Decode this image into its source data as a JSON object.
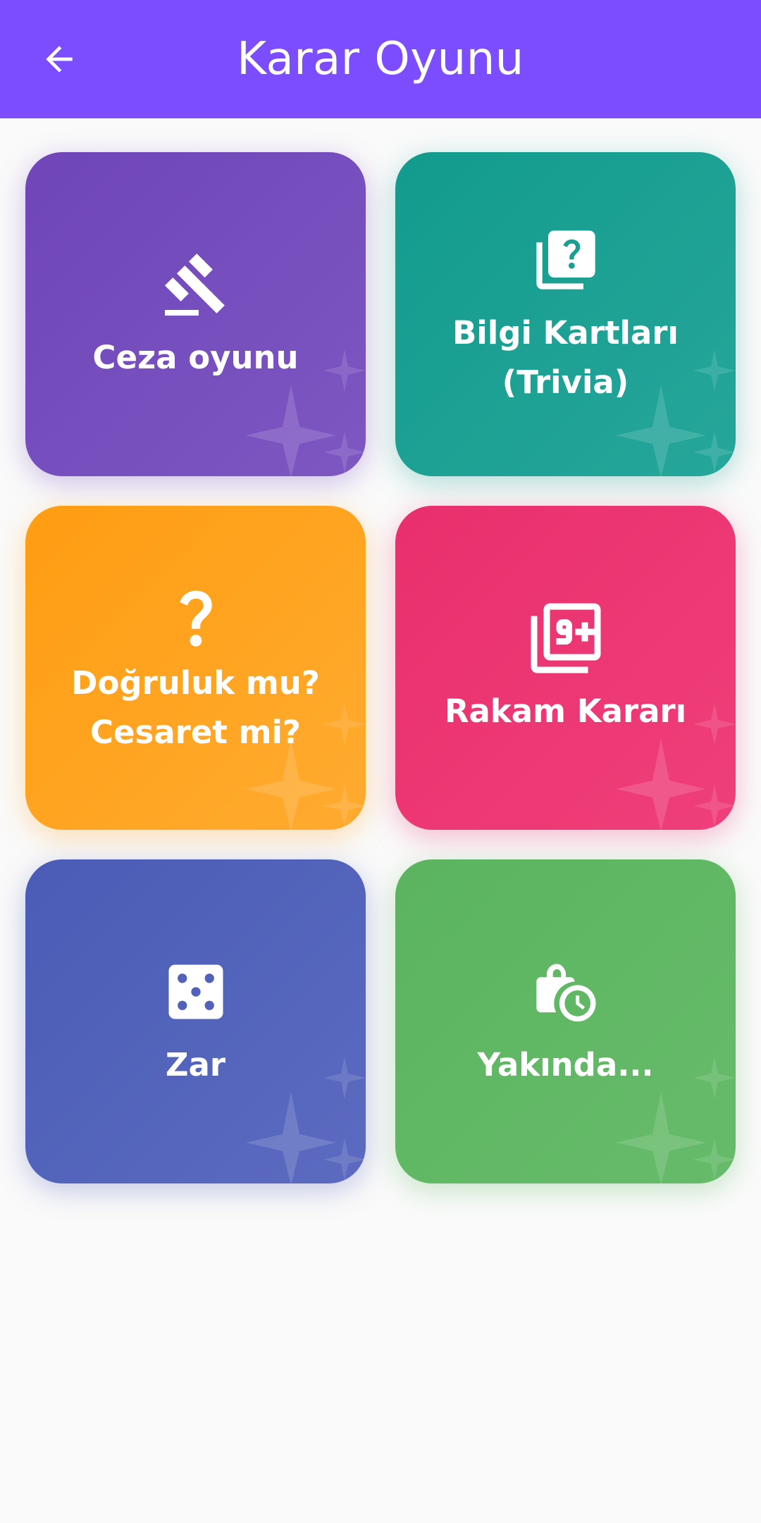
{
  "app_bar": {
    "title": "Karar Oyunu",
    "back_icon": "arrow-back-icon",
    "color": "#7c4dff"
  },
  "cards": [
    {
      "label": "Ceza oyunu",
      "icon": "gavel-icon",
      "color": "#7e57c2"
    },
    {
      "label": "Bilgi Kartları (Trivia)",
      "icon": "quiz-icon",
      "color": "#26a69a"
    },
    {
      "label_line1": "Doğruluk mu?",
      "label_line2": "Cesaret mi?",
      "icon": "question-mark-icon",
      "color": "#ffa726"
    },
    {
      "label": "Rakam Kararı",
      "icon": "filter-9-plus-icon",
      "color": "#ec407a"
    },
    {
      "label": "Zar",
      "icon": "dice-icon",
      "color": "#5c6bc0"
    },
    {
      "label": "Yakında...",
      "icon": "pending-actions-icon",
      "color": "#66bb6a"
    }
  ],
  "background": "#fafafa"
}
